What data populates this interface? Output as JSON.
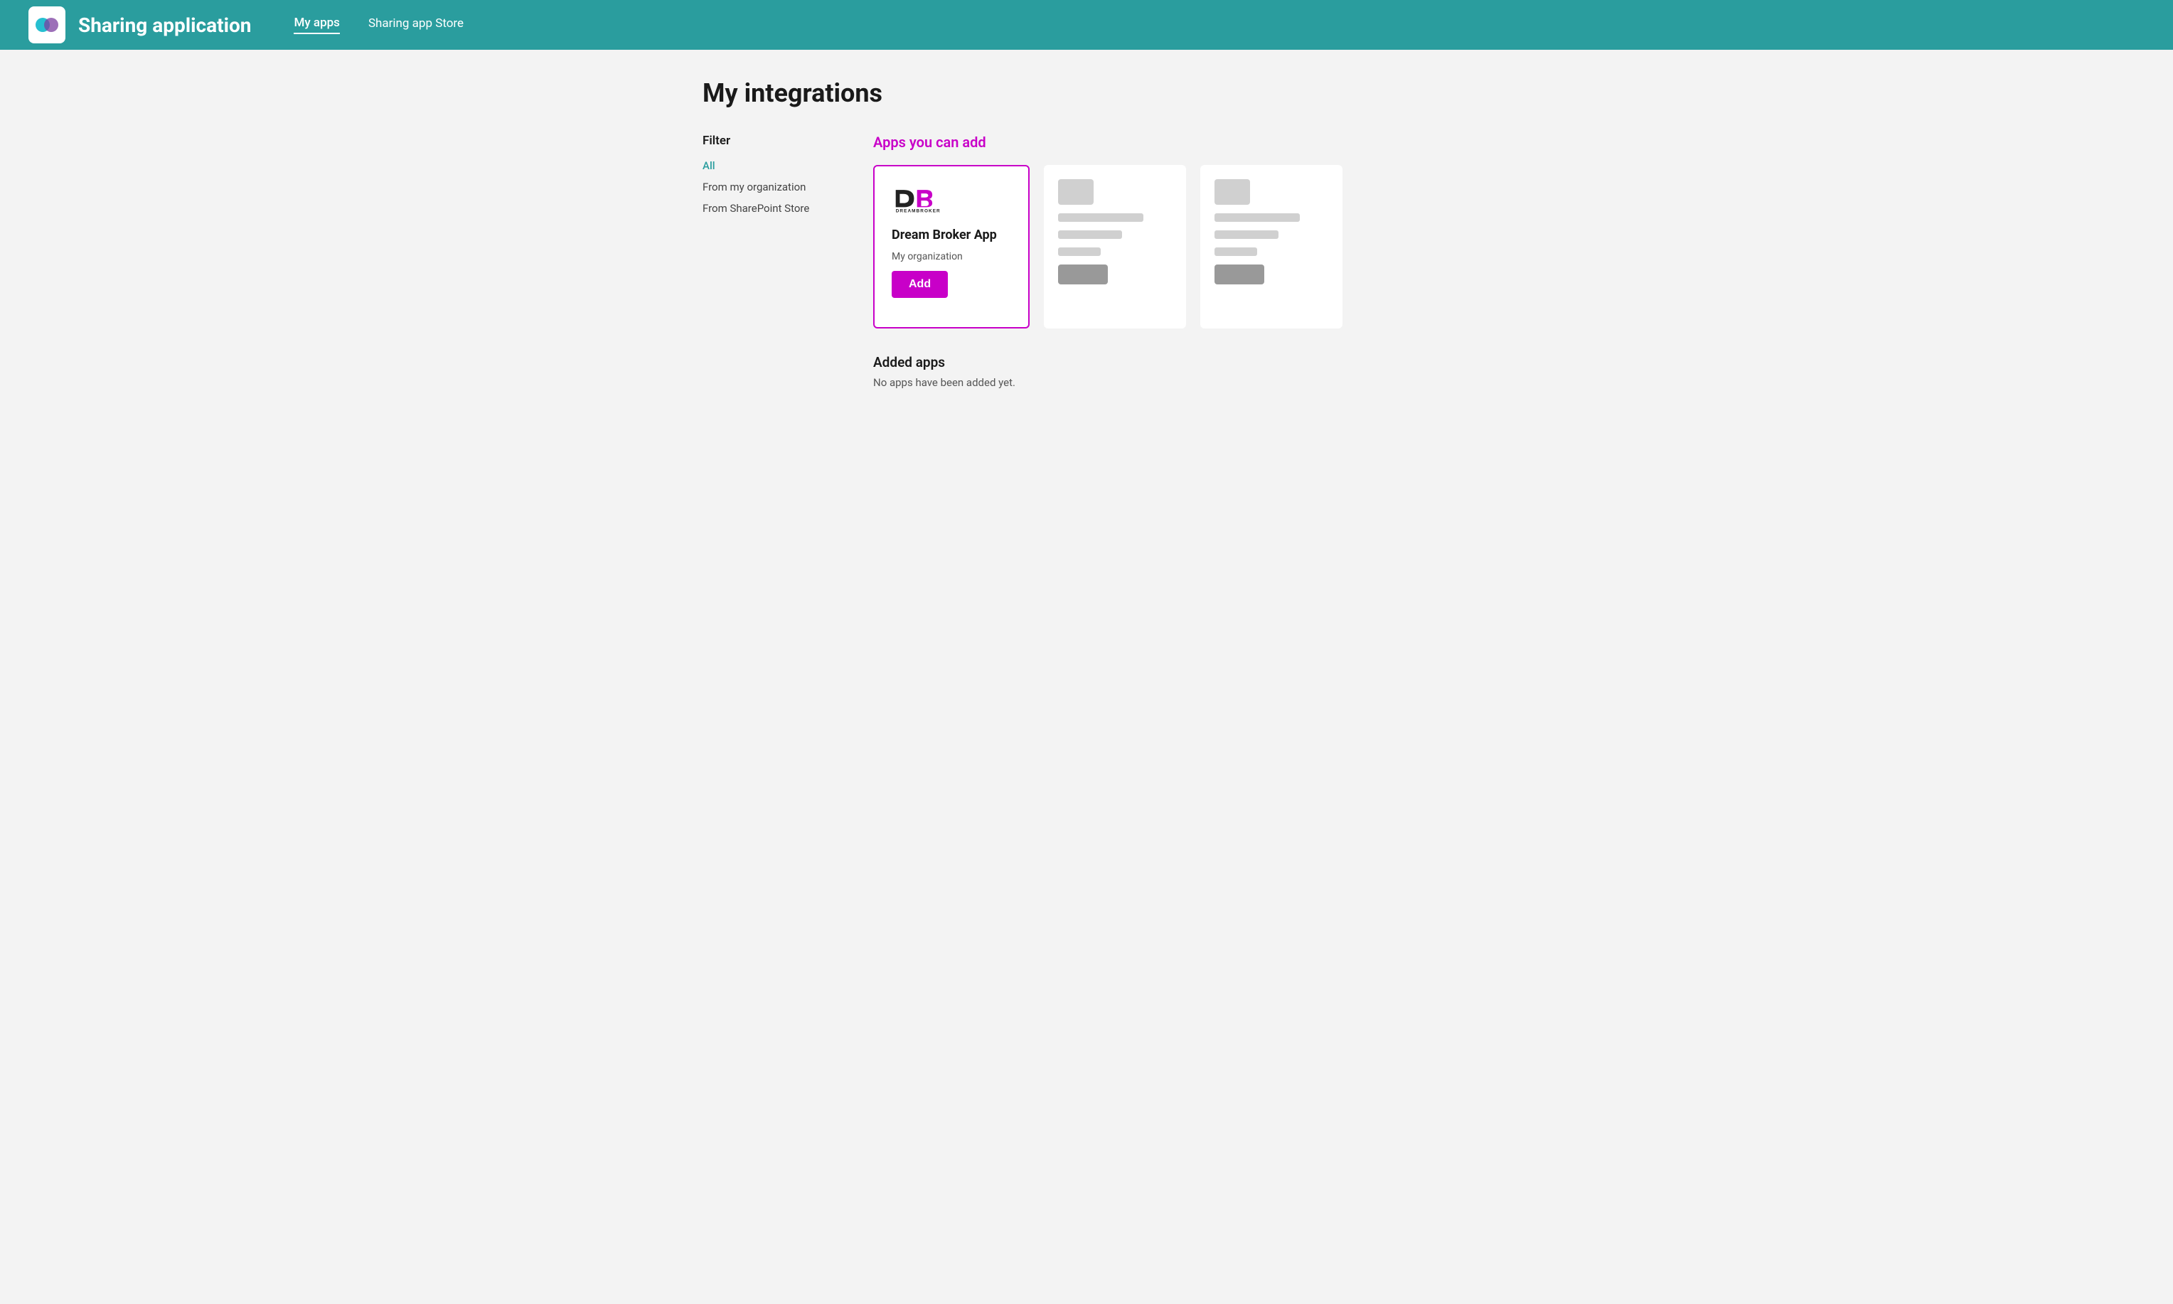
{
  "header": {
    "title": "Sharing application",
    "nav": [
      {
        "label": "My apps",
        "active": true
      },
      {
        "label": "Sharing app Store",
        "active": false
      }
    ]
  },
  "page": {
    "title": "My integrations"
  },
  "filter": {
    "label": "Filter",
    "items": [
      {
        "label": "All",
        "active": true
      },
      {
        "label": "From my organization",
        "active": false
      },
      {
        "label": "From SharePoint Store",
        "active": false
      }
    ]
  },
  "apps_section": {
    "title": "Apps you can add",
    "featured_card": {
      "app_name": "Dream Broker App",
      "org": "My organization",
      "add_label": "Add"
    },
    "added_apps": {
      "title": "Added apps",
      "empty_text": "No apps have been added yet."
    }
  }
}
